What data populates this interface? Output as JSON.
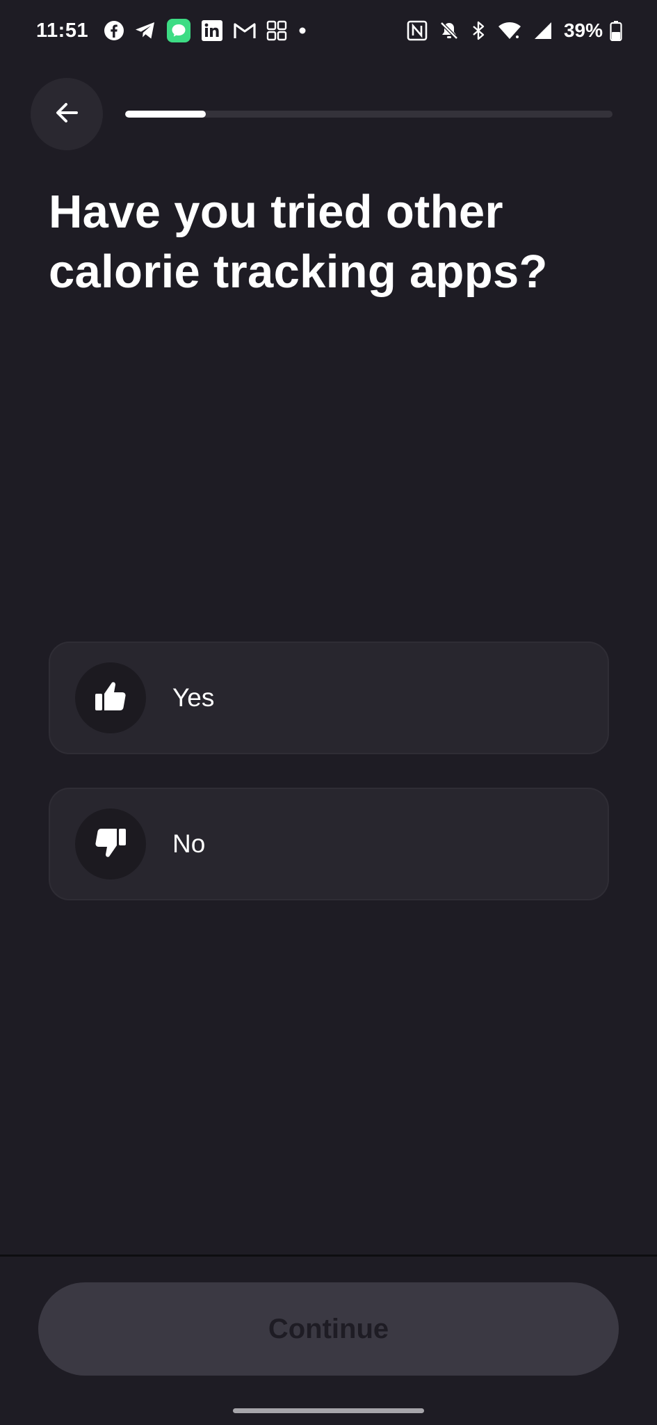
{
  "status_bar": {
    "time": "11:51",
    "notification_icons": [
      "facebook-icon",
      "telegram-icon",
      "messages-icon",
      "linkedin-icon",
      "gmail-icon",
      "grid-app-icon",
      "dot-icon"
    ],
    "system_icons": [
      "nfc-icon",
      "bell-off-icon",
      "bluetooth-icon",
      "wifi-icon",
      "signal-icon",
      "battery-icon"
    ],
    "battery": "39%"
  },
  "header": {
    "back_icon": "arrow-left-icon",
    "progress": 0.165
  },
  "question": {
    "title": "Have you tried other calorie tracking apps?"
  },
  "options": [
    {
      "label": "Yes",
      "icon": "thumbs-up-icon"
    },
    {
      "label": "No",
      "icon": "thumbs-down-icon"
    }
  ],
  "footer": {
    "continue_label": "Continue"
  },
  "colors": {
    "background": "#1e1c24",
    "card": "#28262e",
    "button_disabled": "#3b3943",
    "progress_fill": "#ffffff",
    "messages_badge": "#3ddc84"
  }
}
